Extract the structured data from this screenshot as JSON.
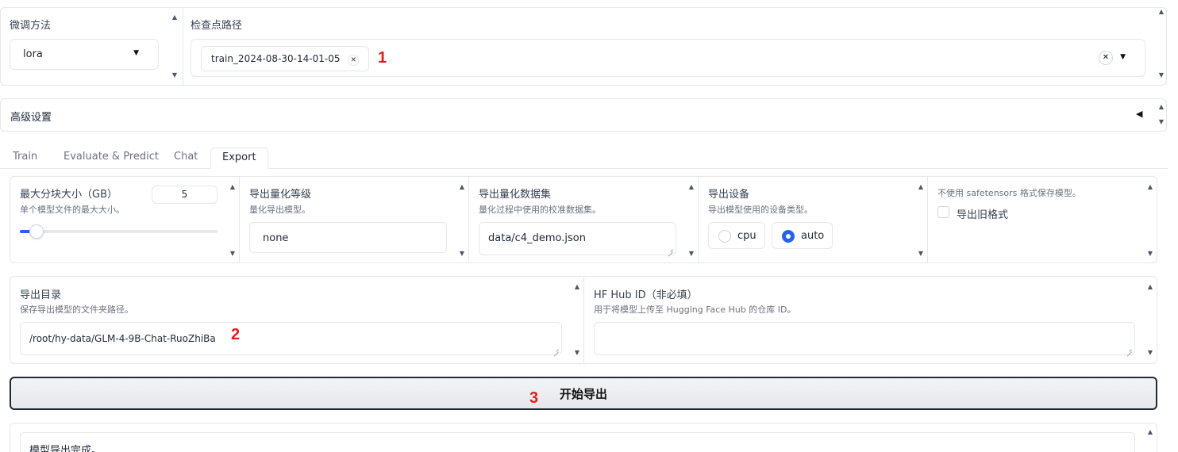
{
  "finetune": {
    "label": "微调方法",
    "value": "lora"
  },
  "checkpoint": {
    "label": "检查点路径",
    "chip": "train_2024-08-30-14-01-05"
  },
  "advanced": {
    "label": "高级设置"
  },
  "tabs": [
    {
      "label": "Train"
    },
    {
      "label": "Evaluate & Predict"
    },
    {
      "label": "Chat"
    },
    {
      "label": "Export"
    }
  ],
  "export": {
    "shard": {
      "label": "最大分块大小（GB）",
      "hint": "单个模型文件的最大大小。",
      "value": "5",
      "slider_fraction": 0.05
    },
    "quant_bit": {
      "label": "导出量化等级",
      "hint": "量化导出模型。",
      "value": "none"
    },
    "quant_dataset": {
      "label": "导出量化数据集",
      "hint": "量化过程中使用的校准数据集。",
      "value": "data/c4_demo.json"
    },
    "device": {
      "label": "导出设备",
      "hint": "导出模型使用的设备类型。",
      "options": [
        "cpu",
        "auto"
      ],
      "selected": "auto"
    },
    "legacy": {
      "hint": "不使用 safetensors 格式保存模型。",
      "label": "导出旧格式"
    },
    "dir": {
      "label": "导出目录",
      "hint": "保存导出模型的文件夹路径。",
      "value": "/root/hy-data/GLM-4-9B-Chat-RuoZhiBa"
    },
    "hub": {
      "label": "HF Hub ID（非必填）",
      "hint": "用于将模型上传至 Hugging Face Hub 的仓库 ID。",
      "value": ""
    },
    "start_button": "开始导出",
    "output": "模型导出完成。"
  },
  "annotations": [
    "1",
    "2",
    "3"
  ],
  "colors": {
    "accent": "#2563eb",
    "annotation": "#e11d1d"
  }
}
